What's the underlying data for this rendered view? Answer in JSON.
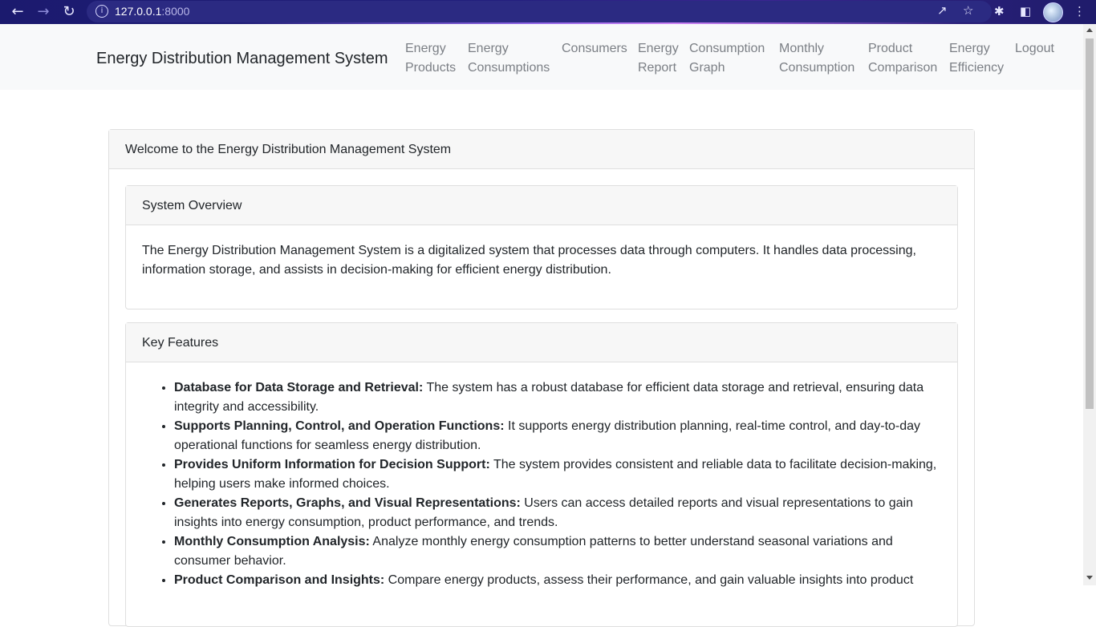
{
  "browser": {
    "url_host": "127.0.0.1",
    "url_port": ":8000"
  },
  "navbar": {
    "brand": "Energy Distribution Management System",
    "items": [
      {
        "line1": "Energy",
        "line2": "Products"
      },
      {
        "line1": "Energy",
        "line2": "Consumptions"
      },
      {
        "line1": "Consumers",
        "line2": ""
      },
      {
        "line1": "Energy",
        "line2": "Report"
      },
      {
        "line1": "Consumption",
        "line2": "Graph"
      },
      {
        "line1": "Monthly",
        "line2": "Consumption"
      },
      {
        "line1": "Product",
        "line2": "Comparison"
      },
      {
        "line1": "Energy",
        "line2": "Efficiency"
      },
      {
        "line1": "Logout",
        "line2": ""
      }
    ]
  },
  "main": {
    "welcome_title": "Welcome to the Energy Distribution Management System",
    "overview": {
      "title": "System Overview",
      "text": "The Energy Distribution Management System is a digitalized system that processes data through computers. It handles data processing, information storage, and assists in decision-making for efficient energy distribution."
    },
    "features": {
      "title": "Key Features",
      "items": [
        {
          "bold": "Database for Data Storage and Retrieval:",
          "text": " The system has a robust database for efficient data storage and retrieval, ensuring data integrity and accessibility."
        },
        {
          "bold": "Supports Planning, Control, and Operation Functions:",
          "text": " It supports energy distribution planning, real-time control, and day-to-day operational functions for seamless energy distribution."
        },
        {
          "bold": "Provides Uniform Information for Decision Support:",
          "text": " The system provides consistent and reliable data to facilitate decision-making, helping users make informed choices."
        },
        {
          "bold": "Generates Reports, Graphs, and Visual Representations:",
          "text": " Users can access detailed reports and visual representations to gain insights into energy consumption, product performance, and trends."
        },
        {
          "bold": "Monthly Consumption Analysis:",
          "text": " Analyze monthly energy consumption patterns to better understand seasonal variations and consumer behavior."
        },
        {
          "bold": "Product Comparison and Insights:",
          "text": " Compare energy products, assess their performance, and gain valuable insights into product"
        }
      ]
    }
  }
}
